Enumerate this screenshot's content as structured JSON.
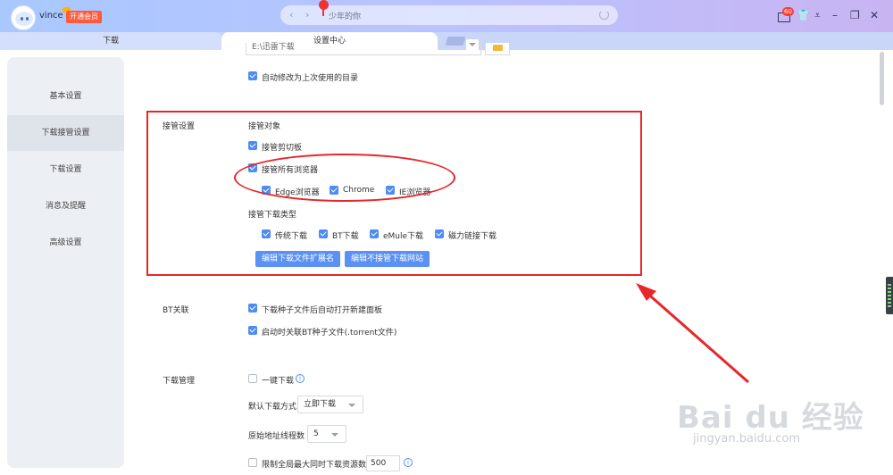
{
  "header": {
    "username": "vince",
    "vip_label": "开通会员",
    "search_text": "少年的你",
    "message_count": "60"
  },
  "tabs": [
    {
      "label": "下载"
    },
    {
      "label": "设置中心"
    }
  ],
  "sidebar": {
    "items": [
      {
        "label": "基本设置"
      },
      {
        "label": "下载接管设置"
      },
      {
        "label": "下载设置"
      },
      {
        "label": "消息及提醒"
      },
      {
        "label": "高级设置"
      }
    ],
    "active_index": 1
  },
  "top_section": {
    "folder_path": "E:\\迅雷下载",
    "auto_modify_label": "自动修改为上次使用的目录"
  },
  "takeover": {
    "section_label": "接管设置",
    "target_heading": "接管对象",
    "clipboard_label": "接管剪切板",
    "all_browsers_label": "接管所有浏览器",
    "browsers": [
      {
        "label": "Edge浏览器"
      },
      {
        "label": "Chrome"
      },
      {
        "label": "IE浏览器"
      }
    ],
    "types_heading": "接管下载类型",
    "types": [
      {
        "label": "传统下载"
      },
      {
        "label": "BT下载"
      },
      {
        "label": "eMule下载"
      },
      {
        "label": "磁力链接下载"
      }
    ],
    "edit_ext_button": "编辑下载文件扩展名",
    "edit_exclude_button": "编辑不接管下载网站"
  },
  "bt": {
    "section_label": "BT关联",
    "open_panel_label": "下载种子文件后自动打开新建面板",
    "associate_label": "启动时关联BT种子文件(.torrent文件)"
  },
  "download_mgmt": {
    "section_label": "下载管理",
    "one_click_label": "一键下载",
    "default_mode_label": "默认下载方式",
    "default_mode_value": "立即下载",
    "threads_label": "原始地址线程数",
    "threads_value": "5",
    "limit_label": "限制全局最大同时下载资源数",
    "limit_value": "500"
  },
  "watermark": {
    "brand": "Bai du 经验",
    "url": "jingyan.baidu.com"
  },
  "colors": {
    "accent": "#4d8cf5",
    "highlight_red": "#e8262a",
    "vip_badge": "#ff5a3c"
  }
}
